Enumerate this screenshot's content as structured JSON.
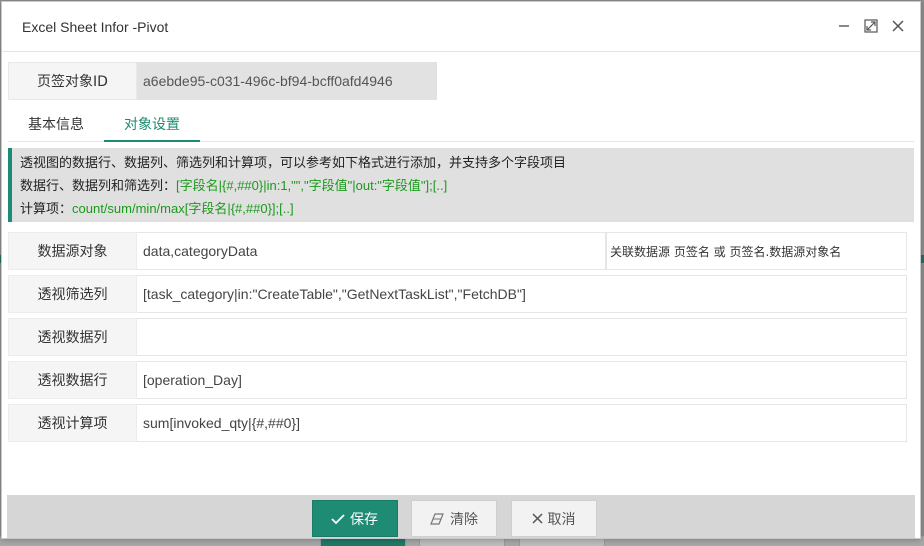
{
  "window": {
    "title": "Excel Sheet Infor -Pivot"
  },
  "object_id": {
    "label": "页签对象ID",
    "value": "a6ebde95-c031-496c-bf94-bcff0afd4946"
  },
  "tabs": [
    {
      "label": "基本信息"
    },
    {
      "label": "对象设置"
    }
  ],
  "hint": {
    "line1": "透视图的数据行、数据列、筛选列和计算项，可以参考如下格式进行添加，并支持多个字段项目",
    "line2_prefix": "数据行、数据列和筛选列：",
    "line2_code": "[字段名|{#,##0}|in:1,\"\",\"字段值\"|out:\"字段值\"];[..]",
    "line3_prefix": "计算项：",
    "line3_code": "count/sum/min/max[字段名|{#,##0}];[..]"
  },
  "form": {
    "data_source": {
      "label": "数据源对象",
      "value": "data,categoryData",
      "note": "关联数据源 页签名 或 页签名.数据源对象名"
    },
    "filter_columns": {
      "label": "透视筛选列",
      "value": "[task_category|in:\"CreateTable\",\"GetNextTaskList\",\"FetchDB\"]"
    },
    "data_columns": {
      "label": "透视数据列",
      "value": ""
    },
    "data_rows": {
      "label": "透视数据行",
      "value": "[operation_Day]"
    },
    "calc_items": {
      "label": "透视计算项",
      "value": "sum[invoked_qty|{#,##0}]"
    }
  },
  "buttons": {
    "save": "保存",
    "clear": "清除",
    "cancel": "取消"
  },
  "colors": {
    "accent": "#1e8c74",
    "hint_code": "#1a9a1a"
  },
  "icons": {
    "minimize": "minimize-icon",
    "maximize": "maximize-icon",
    "close": "close-icon",
    "save": "check-icon",
    "clear": "eraser-icon",
    "cancel": "x-icon"
  }
}
